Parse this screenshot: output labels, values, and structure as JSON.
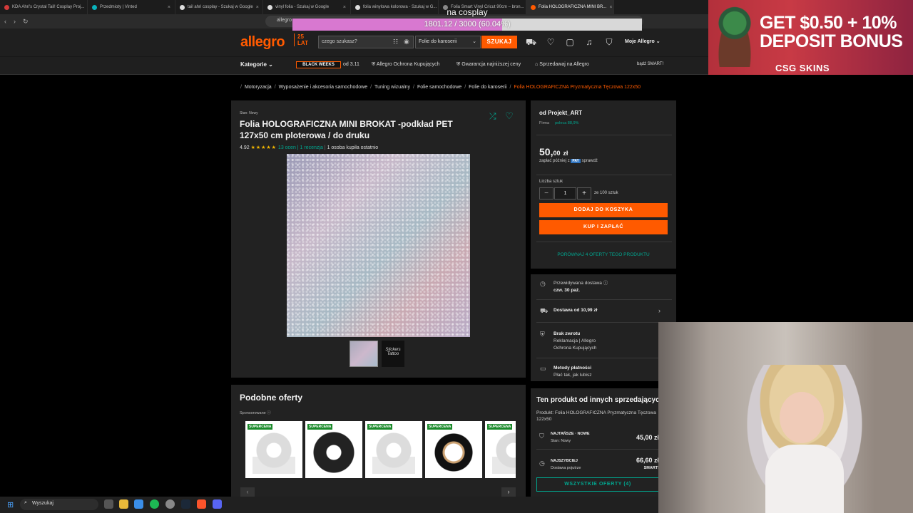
{
  "browser": {
    "tabs": [
      {
        "title": "KDA Ahri's Crystal Tail! Cosplay Proj...",
        "color": "#d33a3a"
      },
      {
        "title": "Przedmioty | Vinted",
        "color": "#09b1ba"
      },
      {
        "title": "tail ahri cosplay - Szukaj w Google",
        "color": "#dddddd"
      },
      {
        "title": "vinyl folia - Szukaj w Google",
        "color": "#dddddd"
      },
      {
        "title": "folia winylowa kolorowa - Szukaj w G...",
        "color": "#dddddd"
      },
      {
        "title": "Folia Smart Vinyl Cricut 90cm – bron...",
        "color": "#888888"
      },
      {
        "title": "Folia HOLOGRAFICZNA MINI BR...",
        "color": "#ff5a00"
      }
    ],
    "address": "allegro"
  },
  "stream_goal": {
    "label": "na cosplay",
    "text": "1801.12 / 3000 (60.04%)",
    "progress": 0.6004
  },
  "header": {
    "logo": "allegro",
    "logo_badge_line1": "25",
    "logo_badge_line2": "LAT",
    "search_placeholder": "czego szukasz?",
    "search_category": "Folie do karoserii",
    "search_button": "SZUKAJ",
    "account": "Moje Allegro"
  },
  "nav": {
    "kategorie": "Kategorie",
    "black_weeks": "BLACK WEEKS",
    "black_weeks_date": "od 3.11",
    "ochrona": "Allegro Ochrona Kupujących",
    "gwarancja": "Gwarancja najniższej ceny",
    "sprzedawaj": "Sprzedawaj na Allegro",
    "smart": "bądź SMART!"
  },
  "breadcrumb": [
    "Motoryzacja",
    "Wyposażenie i akcesoria samochodowe",
    "Tuning wizualny",
    "Folie samochodowe",
    "Folie do karoserii",
    "Folia HOLOGRAFICZNA Pryzmatyczna Tęczowa 122x50"
  ],
  "product": {
    "stan": "Stan: Nowy",
    "title": "Folia HOLOGRAFICZNA MINI BROKAT -podkład PET 127x50 cm ploterowa / do druku",
    "rating": "4.92",
    "stars": "★★★★★",
    "reviews": "13 ocen | 1 recenzja",
    "bought": "1 osoba kupiła ostatnio",
    "thumb2_label": "Stickers Tattoo"
  },
  "buybox": {
    "seller": "od Projekt_ART",
    "firma": "Firma",
    "poleca": "poleca 88,9%",
    "price_main": "50,",
    "price_cents": "00",
    "price_currency": "zł",
    "pay_later_a": "zapłać później z",
    "pay_badge": "PAY",
    "pay_later_b": "sprawdź",
    "qty_label": "Liczba sztuk",
    "qty": "1",
    "qty_of": "ze 100 sztuk",
    "add_to_cart": "DODAJ DO KOSZYKA",
    "buy_now": "KUP I ZAPŁAĆ",
    "compare": "PORÓWNAJ 4 OFERTY TEGO PRODUKTU"
  },
  "delivery": {
    "przewidywana": "Przewidywana dostawa",
    "when": "czw. 30 paź.",
    "dostawa": "Dostawa od 10,99 zł",
    "zwrot_title": "Brak zwrotu",
    "zwrot_line2": "Reklamacja | Allegro",
    "zwrot_line3": "Ochrona Kupujących",
    "platnosci": "Metody płatności",
    "platnosci_sub": "Płać tak, jak lubisz"
  },
  "similar": {
    "title": "Podobne oferty",
    "sponsored": "Sponsorowane",
    "cards": [
      {
        "badge": "SUPERCENA",
        "kind": "clear-tape"
      },
      {
        "badge": "SUPERCENA",
        "kind": "carbon-tape"
      },
      {
        "badge": "SUPERCENA",
        "kind": "clear-tape"
      },
      {
        "badge": "SUPERCENA",
        "kind": "black-tape"
      },
      {
        "badge": "SUPERCENA",
        "kind": "clear-tape"
      }
    ]
  },
  "others": {
    "title": "Ten produkt od innych sprzedających",
    "product": "Produkt: Folia HOLOGRAFICZNA Pryzmatyczna Tęczowa 122x50",
    "row1_label": "NAJTAŃSZE · NOWE",
    "row1_sub": "Stan: Nowy",
    "row1_price": "45,00 zł",
    "row2_label": "NAJSZYBCIEJ",
    "row2_sub": "Dostawa pojutrze",
    "row2_price": "66,60 zł",
    "row2_badge": "SMART!",
    "all_button": "WSZYSTKIE OFERTY (4)"
  },
  "ad": {
    "line1": "GET $0.50 + 10%",
    "line2": "DEPOSIT BONUS",
    "brand": "CSG SKINS"
  },
  "taskbar": {
    "search": "Wyszukaj"
  },
  "colors": {
    "accent": "#ff5a00",
    "teal": "#00a790",
    "goal_fill": "#d878d0"
  }
}
